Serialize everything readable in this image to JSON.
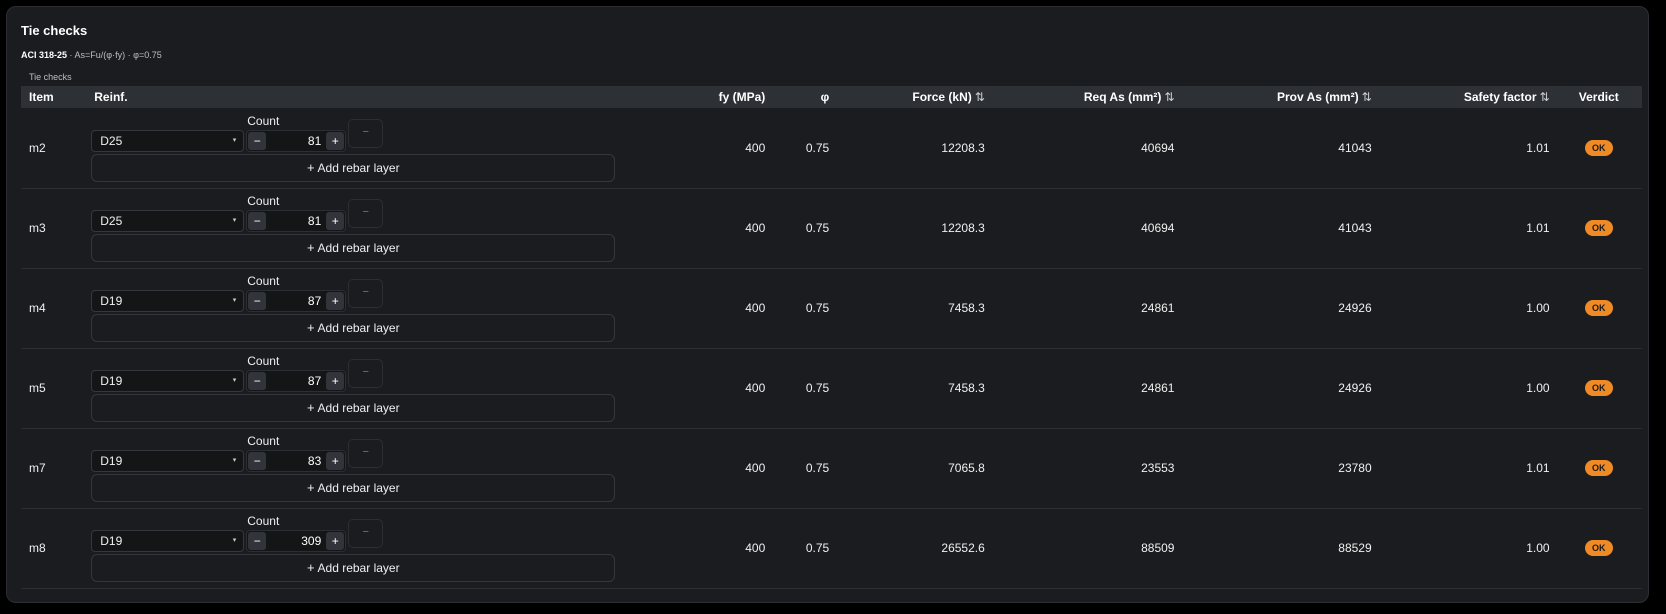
{
  "panel": {
    "title": "Tie checks",
    "code": "ACI 318-25",
    "formula": " · As=Fu/(φ·fy) · φ=0.75",
    "caption": "Tie checks"
  },
  "headers": {
    "item": "Item",
    "reinf": "Reinf.",
    "fy": "fy (MPa)",
    "phi": "φ",
    "force": "Force (kN)",
    "req_as": "Req As (mm²)",
    "prov_as": "Prov As (mm²)",
    "safety": "Safety factor",
    "verdict": "Verdict",
    "sort_glyph": "⇅"
  },
  "controls": {
    "count_label": "Count",
    "minus": "−",
    "plus": "+",
    "remove": "−",
    "add_layer": "Add rebar layer",
    "add_glyph": "+",
    "caret": "▾"
  },
  "colors": {
    "panel_bg": "#1a1c1f",
    "header_bg": "#2d3035",
    "badge_ok": "#f08a24"
  },
  "rows": [
    {
      "item": "m2",
      "bar": "D25",
      "count": "81",
      "fy": "400",
      "phi": "0.75",
      "force": "12208.3",
      "req_as": "40694",
      "prov_as": "41043",
      "sf": "1.01",
      "verdict": "OK"
    },
    {
      "item": "m3",
      "bar": "D25",
      "count": "81",
      "fy": "400",
      "phi": "0.75",
      "force": "12208.3",
      "req_as": "40694",
      "prov_as": "41043",
      "sf": "1.01",
      "verdict": "OK"
    },
    {
      "item": "m4",
      "bar": "D19",
      "count": "87",
      "fy": "400",
      "phi": "0.75",
      "force": "7458.3",
      "req_as": "24861",
      "prov_as": "24926",
      "sf": "1.00",
      "verdict": "OK"
    },
    {
      "item": "m5",
      "bar": "D19",
      "count": "87",
      "fy": "400",
      "phi": "0.75",
      "force": "7458.3",
      "req_as": "24861",
      "prov_as": "24926",
      "sf": "1.00",
      "verdict": "OK"
    },
    {
      "item": "m7",
      "bar": "D19",
      "count": "83",
      "fy": "400",
      "phi": "0.75",
      "force": "7065.8",
      "req_as": "23553",
      "prov_as": "23780",
      "sf": "1.01",
      "verdict": "OK"
    },
    {
      "item": "m8",
      "bar": "D19",
      "count": "309",
      "fy": "400",
      "phi": "0.75",
      "force": "26552.6",
      "req_as": "88509",
      "prov_as": "88529",
      "sf": "1.00",
      "verdict": "OK"
    }
  ]
}
